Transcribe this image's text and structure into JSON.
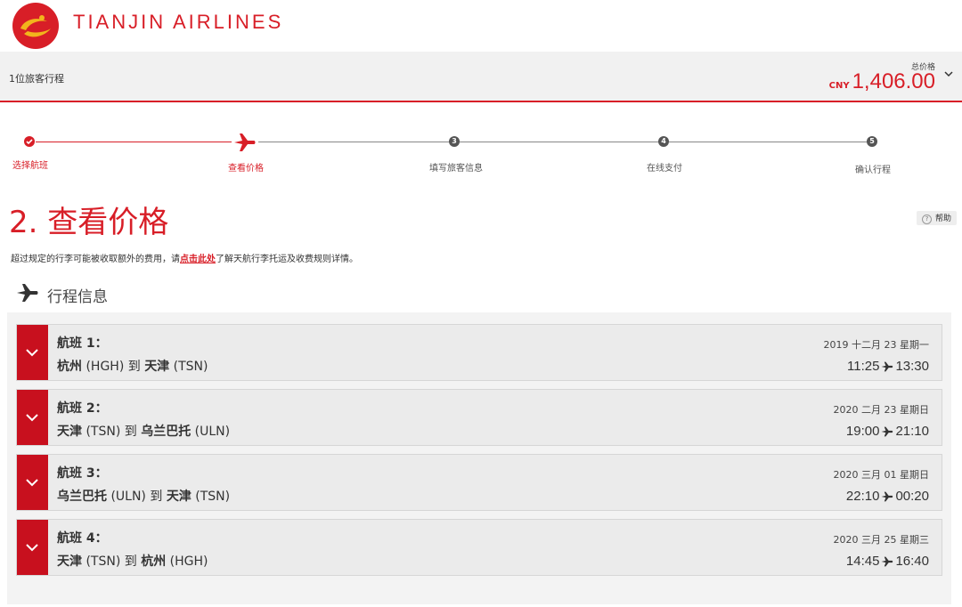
{
  "header": {
    "brand": "TIANJIN AIRLINES"
  },
  "summary": {
    "label": "1位旅客行程",
    "total_label": "总价格",
    "currency": "CNY",
    "amount": "1,406.00"
  },
  "steps": [
    {
      "label": "选择航班",
      "num": "✓"
    },
    {
      "label": "查看价格",
      "num": ""
    },
    {
      "label": "填写旅客信息",
      "num": "3"
    },
    {
      "label": "在线支付",
      "num": "4"
    },
    {
      "label": "确认行程",
      "num": "5"
    }
  ],
  "page": {
    "title": "2. 查看价格",
    "help": "帮助",
    "notice_prefix": "超过规定的行李可能被收取额外的费用，请",
    "notice_link": "点击此处",
    "notice_suffix": "了解天航行李托运及收费规则详情。",
    "section_title": "行程信息"
  },
  "flights": [
    {
      "name": "航班 1：",
      "from_city": "杭州",
      "from_code": "(HGH)",
      "to_word": "到",
      "to_city": "天津",
      "to_code": "(TSN)",
      "date": "2019 十二月 23 星期一",
      "dep": "11:25",
      "arr": "13:30"
    },
    {
      "name": "航班 2：",
      "from_city": "天津",
      "from_code": "(TSN)",
      "to_word": "到",
      "to_city": "乌兰巴托",
      "to_code": "(ULN)",
      "date": "2020 二月 23 星期日",
      "dep": "19:00",
      "arr": "21:10"
    },
    {
      "name": "航班 3：",
      "from_city": "乌兰巴托",
      "from_code": "(ULN)",
      "to_word": "到",
      "to_city": "天津",
      "to_code": "(TSN)",
      "date": "2020 三月 01 星期日",
      "dep": "22:10",
      "arr": "00:20"
    },
    {
      "name": "航班 4：",
      "from_city": "天津",
      "from_code": "(TSN)",
      "to_word": "到",
      "to_city": "杭州",
      "to_code": "(HGH)",
      "date": "2020 三月 25 星期三",
      "dep": "14:45",
      "arr": "16:40"
    }
  ],
  "colors": {
    "brand_red": "#d81e27",
    "toggle_red": "#c8101e"
  }
}
